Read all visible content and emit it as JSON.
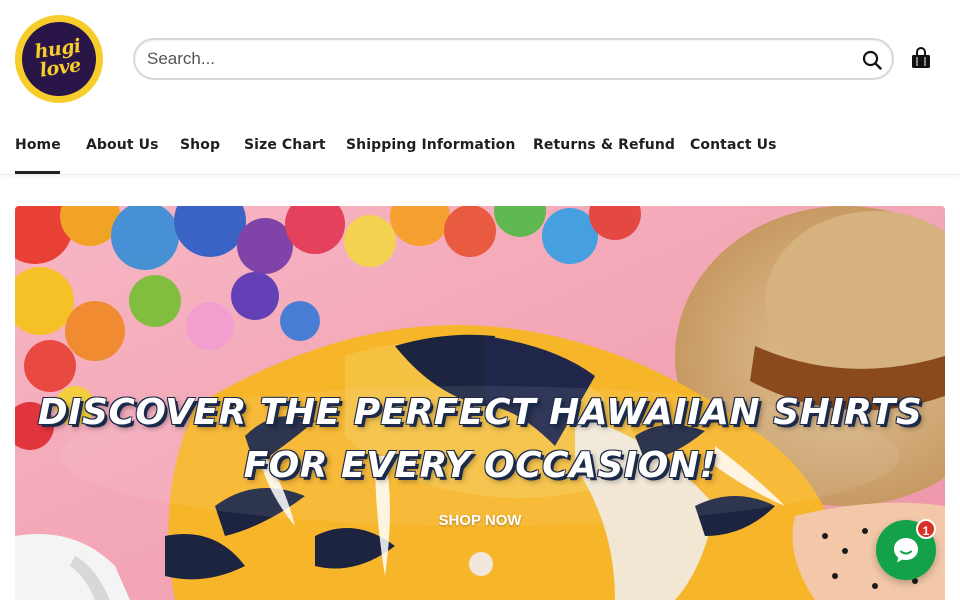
{
  "header": {
    "logo": {
      "line1": "hugi",
      "line2": "love"
    },
    "search": {
      "placeholder": "Search..."
    },
    "cart_icon": "bag-icon"
  },
  "nav": {
    "items": [
      {
        "label": "Home",
        "active": true
      },
      {
        "label": "About Us"
      },
      {
        "label": "Shop"
      },
      {
        "label": "Size Chart"
      },
      {
        "label": "Shipping Information"
      },
      {
        "label": "Returns & Refund"
      },
      {
        "label": "Contact Us"
      }
    ]
  },
  "hero": {
    "title_line1": "DISCOVER THE PERFECT HAWAIIAN SHIRTS",
    "title_line2": "FOR EVERY OCCASION!",
    "cta_label": "SHOP NOW"
  },
  "chat": {
    "badge": "1",
    "color": "#13a24a"
  },
  "colors": {
    "logo_yellow": "#f6cd2a",
    "logo_purple": "#2a1548",
    "hero_pink": "#f2a3b4",
    "shirt_yellow": "#f7b529"
  }
}
